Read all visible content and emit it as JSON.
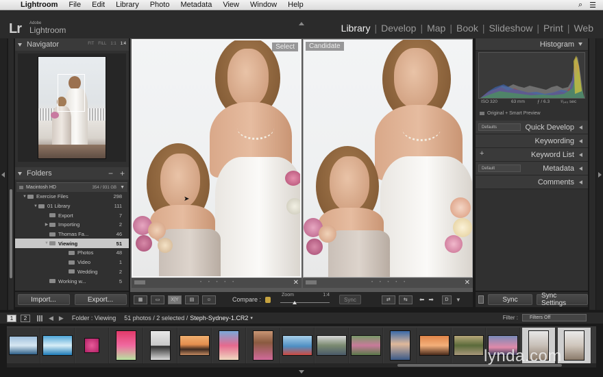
{
  "menubar": {
    "app": "Lightroom",
    "items": [
      "File",
      "Edit",
      "Library",
      "Photo",
      "Metadata",
      "View",
      "Window",
      "Help"
    ]
  },
  "header": {
    "logo_mark": "Lr",
    "logo_adobe": "Adobe",
    "logo_name": "Lightroom",
    "modules": [
      "Library",
      "Develop",
      "Map",
      "Book",
      "Slideshow",
      "Print",
      "Web"
    ],
    "active_module": "Library"
  },
  "navigator": {
    "title": "Navigator",
    "zoom_options": [
      "FIT",
      "FILL",
      "1:1",
      "1:4"
    ],
    "selected_zoom": "1:4"
  },
  "folders": {
    "title": "Folders",
    "controls": [
      "−",
      "+"
    ],
    "volume": {
      "name": "Macintosh HD",
      "capacity": "354 / 931 GB"
    },
    "rows": [
      {
        "name": "Exercise Files",
        "count": "298",
        "level": 1,
        "expand": "▼"
      },
      {
        "name": "01 Library",
        "count": "111",
        "level": 2,
        "expand": "▼"
      },
      {
        "name": "Export",
        "count": "7",
        "level": 3,
        "expand": ""
      },
      {
        "name": "Importing",
        "count": "2",
        "level": 3,
        "expand": "▶"
      },
      {
        "name": "Thomas Fa...",
        "count": "46",
        "level": 3,
        "expand": ""
      },
      {
        "name": "Viewing",
        "count": "51",
        "level": 3,
        "expand": "▼",
        "selected": true
      },
      {
        "name": "Photos",
        "count": "48",
        "level": 4,
        "expand": ""
      },
      {
        "name": "Video",
        "count": "1",
        "level": 4,
        "expand": ""
      },
      {
        "name": "Wedding",
        "count": "2",
        "level": 4,
        "expand": ""
      },
      {
        "name": "Working w...",
        "count": "5",
        "level": 3,
        "expand": ""
      }
    ]
  },
  "left_buttons": {
    "import": "Import...",
    "export": "Export..."
  },
  "compare": {
    "select_label": "Select",
    "candidate_label": "Candidate"
  },
  "toolbar": {
    "compare_label": "Compare :",
    "zoom_label": "Zoom",
    "zoom_value": "1:4",
    "sync_label": "Sync",
    "done_label": "D",
    "survey_label": "X|Y",
    "swap_icon": "swap-icon",
    "make_select_icon": "make-select-icon"
  },
  "histogram": {
    "title": "Histogram",
    "iso": "ISO 320",
    "focal": "63 mm",
    "aperture": "ƒ / 6.3",
    "shutter": "¹⁄₆₄₀ sec",
    "preview_status": "Original + Smart Preview"
  },
  "right_panels": [
    {
      "title": "Quick Develop",
      "preset": "Defaults"
    },
    {
      "title": "Keywording"
    },
    {
      "title": "Keyword List",
      "plus": "+"
    },
    {
      "title": "Metadata",
      "preset": "Default"
    },
    {
      "title": "Comments"
    }
  ],
  "right_buttons": {
    "sync": "Sync",
    "sync_settings": "Sync Settings"
  },
  "filmstrip_bar": {
    "screen1": "1",
    "screen2": "2",
    "source": "Folder : Viewing",
    "count_info": "51 photos / 2 selected /",
    "filename": "Steph-Sydney-1.CR2",
    "filter_label": "Filter :",
    "filter_value": "Filters Off"
  },
  "watermark": "lynda.com",
  "colors": {
    "accent": "#f0f0f0",
    "panel": "#303030",
    "lock": "#c6a340"
  }
}
